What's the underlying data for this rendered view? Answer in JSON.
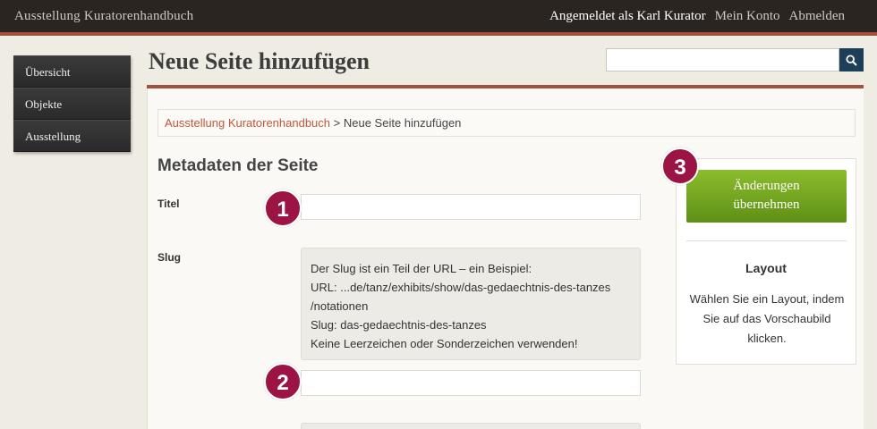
{
  "header": {
    "site_title": "Ausstellung Kuratorenhandbuch",
    "logged_in_as": "Angemeldet als Karl Kurator",
    "account_link": "Mein Konto",
    "logout_link": "Abmelden"
  },
  "sidebar": {
    "items": [
      {
        "label": "Übersicht"
      },
      {
        "label": "Objekte"
      },
      {
        "label": "Ausstellung"
      }
    ]
  },
  "page": {
    "title": "Neue Seite hinzufügen"
  },
  "search": {
    "value": "",
    "icon": "search-icon"
  },
  "breadcrumb": {
    "parent": "Ausstellung Kuratorenhandbuch",
    "separator": " > ",
    "current": "Neue Seite hinzufügen"
  },
  "form": {
    "section_heading": "Metadaten der Seite",
    "title_label": "Titel",
    "title_value": "",
    "slug_label": "Slug",
    "slug_value": "",
    "slug_hint": [
      "Der Slug ist ein Teil der URL – ein Beispiel:",
      "URL: ...de/tanz/exhibits/show/das-gedaechtnis-des-tanzes",
      "/notationen",
      "Slug: das-gedaechtnis-des-tanzes",
      "Keine Leerzeichen oder Sonderzeichen verwenden!"
    ]
  },
  "side_panel": {
    "save_label_line1": "Änderungen",
    "save_label_line2": "übernehmen",
    "layout_heading": "Layout",
    "layout_desc_1": "Wählen Sie ein Layout, indem",
    "layout_desc_2": "Sie auf das Vorschaubild",
    "layout_desc_3": "klicken."
  },
  "markers": {
    "one": "1",
    "two": "2",
    "three": "3"
  },
  "colors": {
    "accent": "#a0523d",
    "link": "#c0583a",
    "marker": "#9c1444",
    "save_button": "#7aab24",
    "topbar": "#2b2521",
    "search_button": "#1e3f57"
  }
}
